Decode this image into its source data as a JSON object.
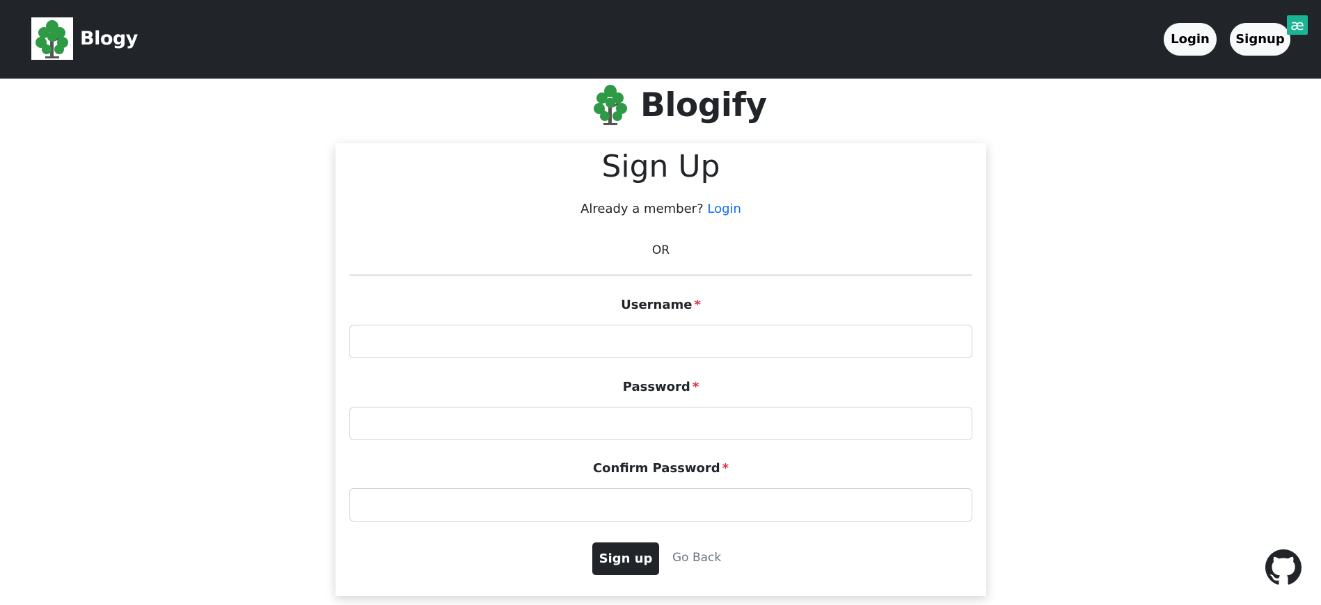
{
  "navbar": {
    "brand": "Blogy",
    "login_label": "Login",
    "signup_label": "Signup",
    "badge": "æ",
    "background": "#212529"
  },
  "hero": {
    "title": "Blogify"
  },
  "signup_form": {
    "title": "Sign Up",
    "member_prompt": "Already a member?",
    "login_link": "Login",
    "separator": "OR",
    "fields": [
      {
        "label": "Username",
        "required_mark": "*",
        "value": ""
      },
      {
        "label": "Password",
        "required_mark": "*",
        "value": ""
      },
      {
        "label": "Confirm Password",
        "required_mark": "*",
        "value": ""
      }
    ],
    "submit_label": "Sign up",
    "go_back_label": "Go Back"
  },
  "icons": {
    "logo": "tree-icon",
    "github": "github-icon"
  },
  "colors": {
    "brand_green": "#2e9a46",
    "link": "#0d6efd",
    "required": "#dc3545",
    "badge": "#1ab394"
  }
}
